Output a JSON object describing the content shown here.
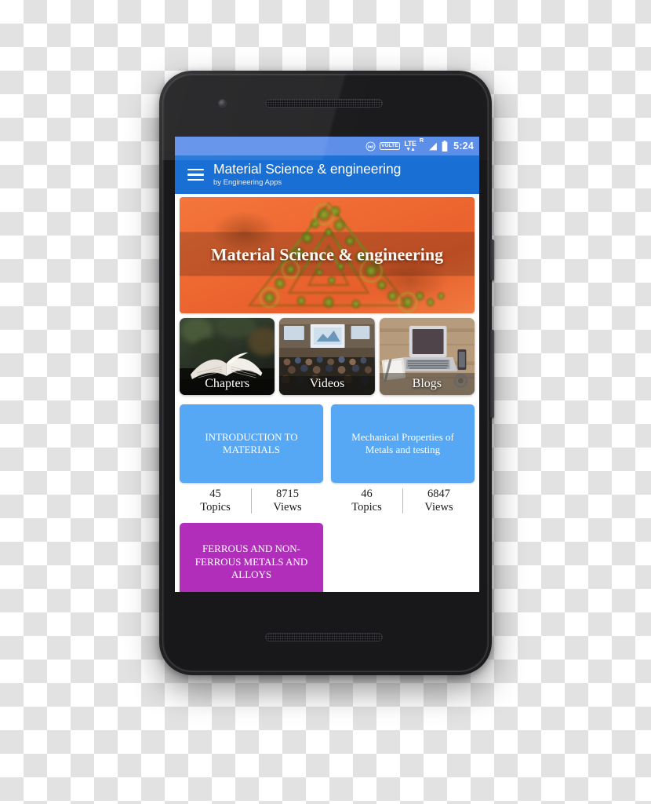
{
  "statusbar": {
    "icons": [
      "hotspot-icon",
      "volte-icon",
      "lte-icon",
      "roaming-icon",
      "signal-icon",
      "battery-icon"
    ],
    "volte_label": "VOLTE",
    "lte_label": "LTE",
    "roaming_label": "R",
    "time": "5:24"
  },
  "appbar": {
    "menu_icon": "hamburger-menu-icon",
    "title": "Material Science & engineering",
    "subtitle": "by Engineering Apps"
  },
  "hero": {
    "title": "Material Science & engineering"
  },
  "tiles": [
    {
      "label": "Chapters",
      "icon": "open-book-image"
    },
    {
      "label": "Videos",
      "icon": "lecture-hall-image"
    },
    {
      "label": "Blogs",
      "icon": "laptop-desk-image"
    }
  ],
  "topic_cards": [
    {
      "title": "INTRODUCTION TO MATERIALS",
      "color": "#56a8f5",
      "topics_count": "45",
      "topics_label": "Topics",
      "views_count": "8715",
      "views_label": "Views"
    },
    {
      "title": "Mechanical Properties of Metals and testing",
      "color": "#56a8f5",
      "topics_count": "46",
      "topics_label": "Topics",
      "views_count": "6847",
      "views_label": "Views"
    },
    {
      "title": "FERROUS AND NON-FERROUS METALS AND ALLOYS",
      "color": "#b12ebb"
    }
  ],
  "navbar": {
    "back_label": "back-button",
    "home_label": "home-button",
    "recents_label": "recents-button"
  },
  "theme": {
    "appbar_color": "#1a6fd4",
    "statusbar_color": "#5b8de8",
    "card_blue": "#56a8f5",
    "card_magenta": "#b12ebb",
    "hero_orange": "#ef6a33"
  }
}
